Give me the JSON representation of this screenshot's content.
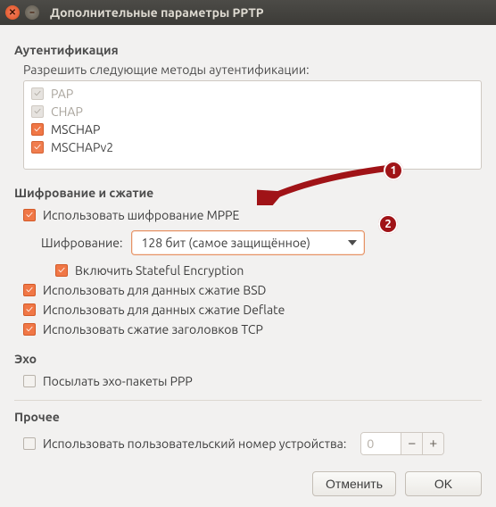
{
  "window": {
    "title": "Дополнительные параметры PPTP"
  },
  "auth": {
    "section": "Аутентификация",
    "prompt": "Разрешить следующие методы аутентификации:",
    "methods": {
      "pap": "PAP",
      "chap": "CHAP",
      "mschap": "MSCHAP",
      "mschapv2": "MSCHAPv2"
    }
  },
  "enc": {
    "section": "Шифрование и сжатие",
    "mppe": "Использовать шифрование MPPE",
    "cipher_label": "Шифрование:",
    "cipher_value": "128 бит (самое защищённое)",
    "stateful": "Включить Stateful Encryption",
    "bsd": "Использовать для данных сжатие BSD",
    "deflate": "Использовать для данных сжатие Deflate",
    "tcp": "Использовать сжатие заголовков TCP"
  },
  "echo": {
    "section": "Эхо",
    "ppp": "Посылать эхо-пакеты PPP"
  },
  "misc": {
    "section": "Прочее",
    "custom_unit": "Использовать пользовательский номер устройства:",
    "unit_value": "0"
  },
  "buttons": {
    "cancel": "Отменить",
    "ok": "OK"
  },
  "badges": {
    "one": "1",
    "two": "2"
  }
}
